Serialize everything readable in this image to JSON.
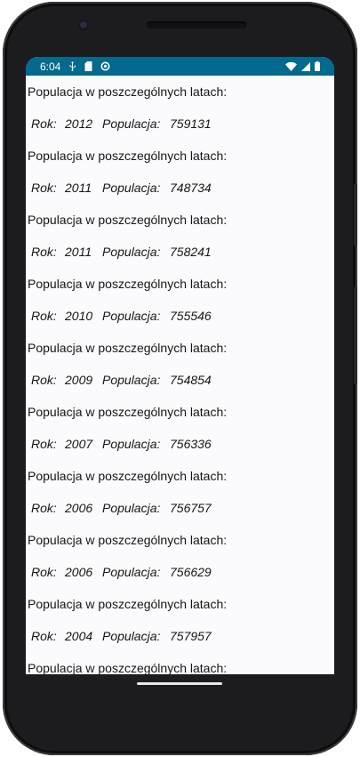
{
  "status_bar": {
    "time": "6:04",
    "left_icons": [
      "usb-icon",
      "sd-card-icon",
      "sync-icon"
    ],
    "right_icons": [
      "wifi-icon",
      "signal-icon",
      "battery-icon"
    ],
    "color": "#016a8e"
  },
  "list": {
    "entries": [
      {
        "heading": "Populacja w poszczególnych latach:",
        "rok_label": "Rok:",
        "year": "2012",
        "pop_label": "Populacja:",
        "population": "759131"
      },
      {
        "heading": "Populacja w poszczególnych latach:",
        "rok_label": "Rok:",
        "year": "2011",
        "pop_label": "Populacja:",
        "population": "748734"
      },
      {
        "heading": "Populacja w poszczególnych latach:",
        "rok_label": "Rok:",
        "year": "2011",
        "pop_label": "Populacja:",
        "population": "758241"
      },
      {
        "heading": "Populacja w poszczególnych latach:",
        "rok_label": "Rok:",
        "year": "2010",
        "pop_label": "Populacja:",
        "population": "755546"
      },
      {
        "heading": "Populacja w poszczególnych latach:",
        "rok_label": "Rok:",
        "year": "2009",
        "pop_label": "Populacja:",
        "population": "754854"
      },
      {
        "heading": "Populacja w poszczególnych latach:",
        "rok_label": "Rok:",
        "year": "2007",
        "pop_label": "Populacja:",
        "population": "756336"
      },
      {
        "heading": "Populacja w poszczególnych latach:",
        "rok_label": "Rok:",
        "year": "2006",
        "pop_label": "Populacja:",
        "population": "756757"
      },
      {
        "heading": "Populacja w poszczególnych latach:",
        "rok_label": "Rok:",
        "year": "2006",
        "pop_label": "Populacja:",
        "population": "756629"
      },
      {
        "heading": "Populacja w poszczególnych latach:",
        "rok_label": "Rok:",
        "year": "2004",
        "pop_label": "Populacja:",
        "population": "757957"
      },
      {
        "heading": "Populacja w poszczególnych latach:"
      }
    ]
  }
}
